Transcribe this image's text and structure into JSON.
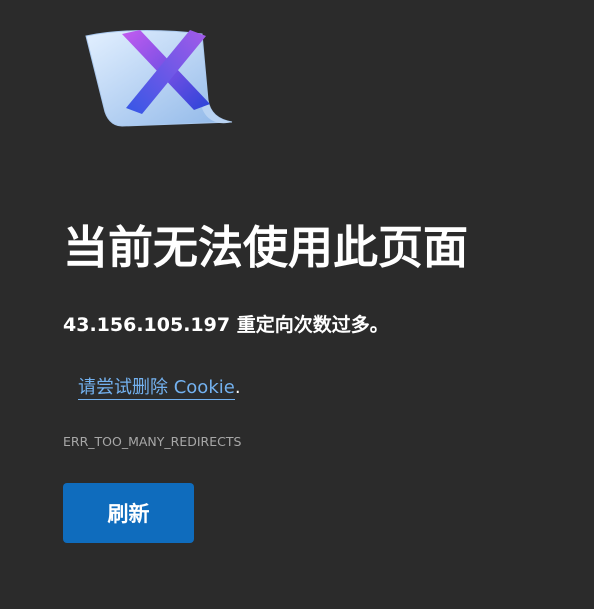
{
  "error": {
    "icon": "error-x-document-icon",
    "title": "当前无法使用此页面",
    "message": "43.156.105.197 重定向次数过多。",
    "suggestion_link": "请尝试删除 Cookie",
    "suggestion_suffix": ".",
    "code": "ERR_TOO_MANY_REDIRECTS"
  },
  "actions": {
    "refresh_label": "刷新"
  },
  "colors": {
    "background": "#2b2b2b",
    "link": "#73b1ef",
    "button": "#0f6cbd",
    "error_code_text": "#a8a8a8"
  }
}
